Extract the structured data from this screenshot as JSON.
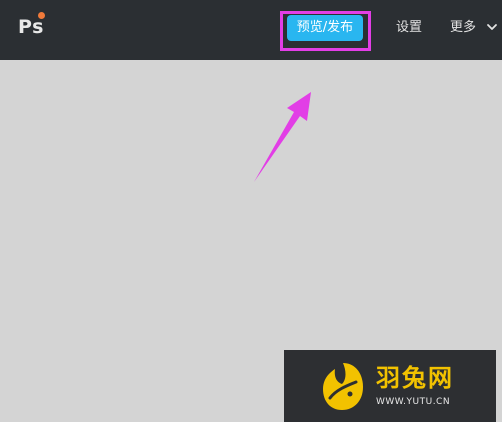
{
  "app": {
    "logo_text": "Ps"
  },
  "header": {
    "publish_label": "预览/发布",
    "settings_label": "设置",
    "more_label": "更多"
  },
  "watermark": {
    "title": "羽兔网",
    "url": "WWW.YUTU.CN"
  },
  "colors": {
    "topbar": "#2b2f33",
    "canvas": "#d4d4d4",
    "accent_button": "#29b6f0",
    "highlight": "#e23ee6",
    "logo_dot": "#f07a3a",
    "watermark_accent": "#f2c200"
  },
  "icons": {
    "more_dropdown": "chevron-down-icon",
    "annotation": "arrow-icon",
    "brand": "rabbit-logo-icon"
  }
}
